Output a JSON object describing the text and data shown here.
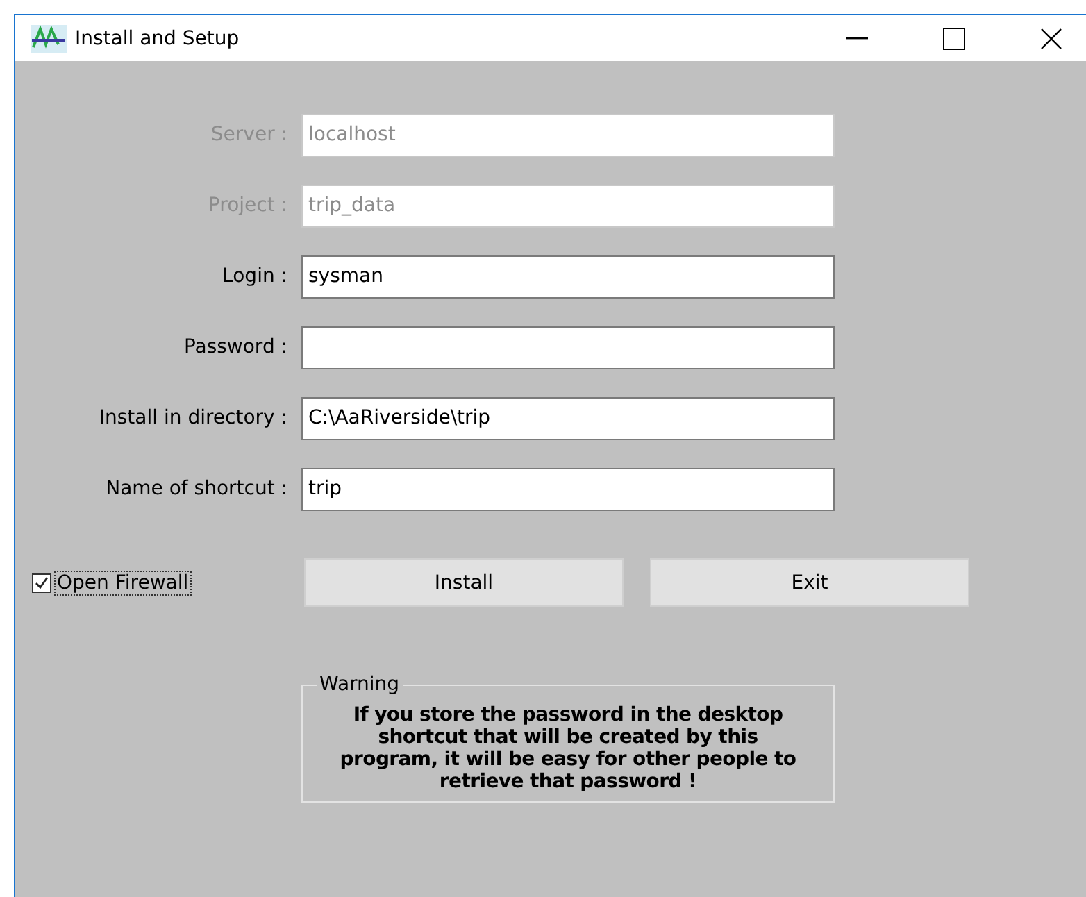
{
  "window": {
    "title": "Install and Setup"
  },
  "fields": [
    {
      "label": "Server :",
      "value": "localhost",
      "disabled": true
    },
    {
      "label": "Project :",
      "value": "trip_data",
      "disabled": true
    },
    {
      "label": "Login :",
      "value": "sysman",
      "disabled": false
    },
    {
      "label": "Password :",
      "disabled": false
    },
    {
      "label": "Install in directory :",
      "value": "C:\\AaRiverside\\trip",
      "disabled": false
    },
    {
      "label": "Name of shortcut :",
      "value": "trip",
      "disabled": false
    }
  ],
  "open_firewall": {
    "label": "Open Firewall",
    "checked": true
  },
  "buttons": [
    "Install",
    "Exit"
  ],
  "warning": {
    "title": "Warning",
    "text": "If you store the password in the desktop shortcut that will be created by this program, it will be easy for other people to retrieve that password !"
  }
}
